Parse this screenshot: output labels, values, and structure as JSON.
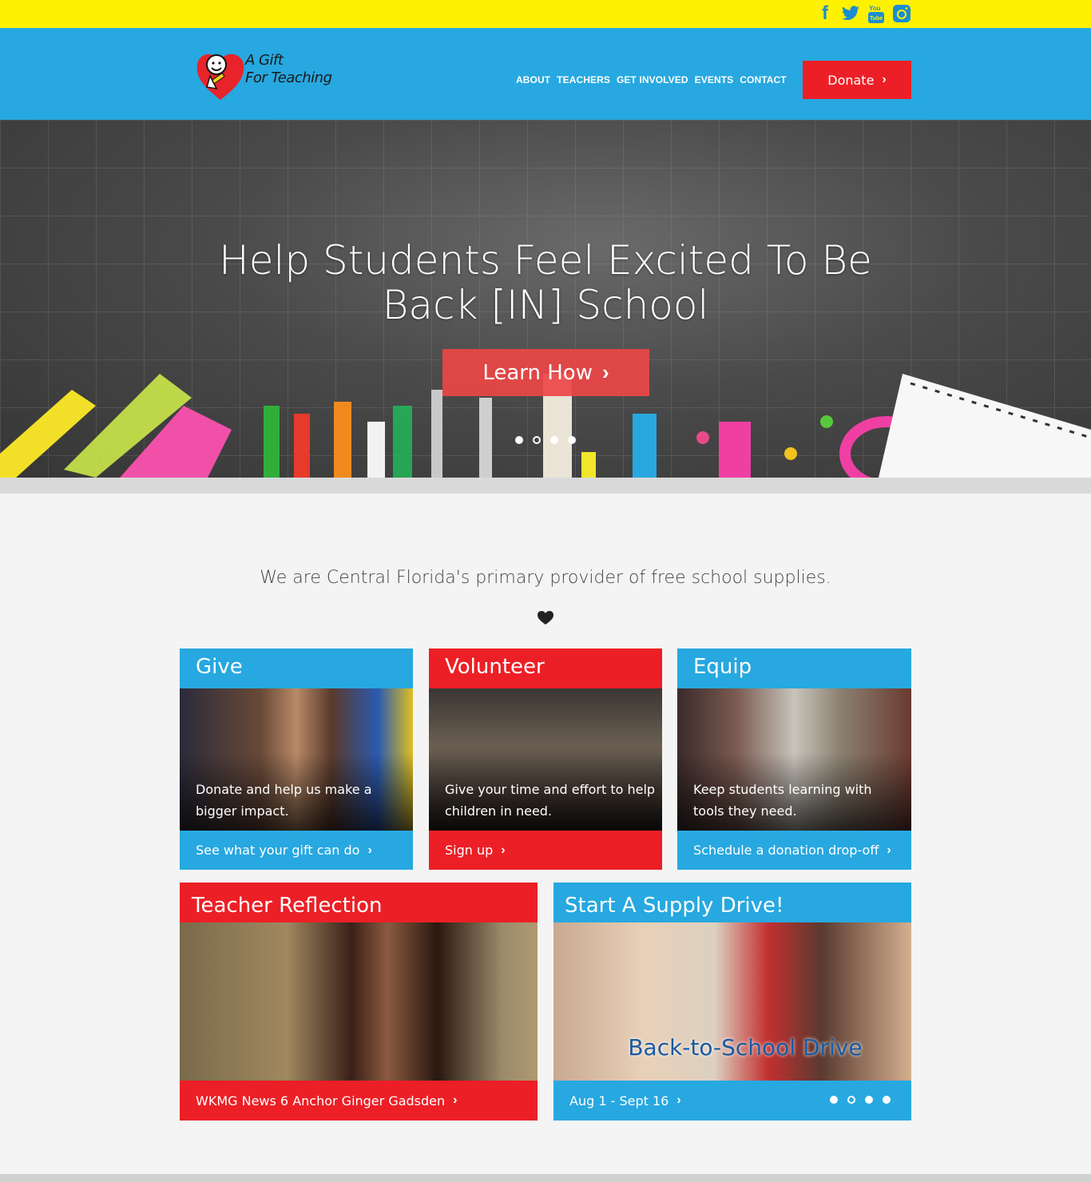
{
  "social": {
    "facebook": "f",
    "twitter_icon": "twitter-bird",
    "youtube_icon": "youtube",
    "instagram_icon": "instagram"
  },
  "brand": {
    "line1": "A Gift",
    "line2": "For Teaching"
  },
  "nav": [
    "ABOUT",
    "TEACHERS",
    "GET INVOLVED",
    "EVENTS",
    "CONTACT"
  ],
  "donate_label": "Donate",
  "hero": {
    "title_line1": "Help Students Feel Excited To Be",
    "title_line2": "Back [IN] School",
    "cta": "Learn How",
    "slides": 4,
    "active_slide": 1
  },
  "tagline": "We are Central Florida's primary provider of free school supplies.",
  "cards": {
    "give": {
      "title": "Give",
      "caption_l1": "Donate and help us make a",
      "caption_l2": "bigger impact.",
      "link": "See what your gift can do"
    },
    "volunteer": {
      "title": "Volunteer",
      "caption_l1": "Give your time and effort to help",
      "caption_l2": "children in need.",
      "link": "Sign up"
    },
    "equip": {
      "title": "Equip",
      "caption_l1": "Keep students learning with",
      "caption_l2": "tools they need.",
      "link": "Schedule a donation drop-off"
    },
    "reflection": {
      "title": "Teacher Reflection",
      "link": "WKMG News 6 Anchor Ginger Gadsden"
    },
    "drive": {
      "title": "Start A Supply Drive!",
      "overlay": "Back-to-School Drive",
      "link": "Aug 1 - Sept 16",
      "slides": 4,
      "active_slide": 2
    }
  },
  "colors": {
    "yellow": "#fff200",
    "blue": "#27a8e0",
    "red": "#ec1f26"
  }
}
